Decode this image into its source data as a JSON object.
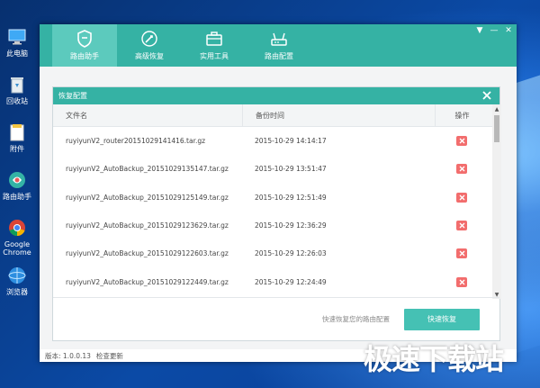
{
  "desktop": {
    "icons": [
      {
        "label": "此电脑",
        "icon": "computer-icon"
      },
      {
        "label": "回收站",
        "icon": "recycle-bin-icon"
      },
      {
        "label": "附件",
        "icon": "folder-icon"
      },
      {
        "label": "路由助手",
        "icon": "router-helper-icon"
      },
      {
        "label": "Google Chrome",
        "icon": "chrome-icon"
      },
      {
        "label": "浏览器",
        "icon": "browser-icon"
      }
    ]
  },
  "app": {
    "tabs": [
      {
        "label": "路由助手",
        "icon": "shield-icon",
        "active": true
      },
      {
        "label": "高级恢复",
        "icon": "rocket-icon",
        "active": false
      },
      {
        "label": "实用工具",
        "icon": "toolbox-icon",
        "active": false
      },
      {
        "label": "路由配置",
        "icon": "router-icon",
        "active": false
      }
    ],
    "window_controls": {
      "menu": "▼",
      "minimize": "—",
      "close": "✕"
    },
    "status": {
      "version": "版本: 1.0.0.13",
      "check_update": "检查更新"
    }
  },
  "dialog": {
    "title": "恢复配置",
    "columns": {
      "name": "文件名",
      "time": "备份时间",
      "action": "操作"
    },
    "rows": [
      {
        "name": "ruyiyunV2_router20151029141416.tar.gz",
        "time": "2015-10-29 14:14:17"
      },
      {
        "name": "ruyiyunV2_AutoBackup_20151029135147.tar.gz",
        "time": "2015-10-29 13:51:47"
      },
      {
        "name": "ruyiyunV2_AutoBackup_20151029125149.tar.gz",
        "time": "2015-10-29 12:51:49"
      },
      {
        "name": "ruyiyunV2_AutoBackup_20151029123629.tar.gz",
        "time": "2015-10-29 12:36:29"
      },
      {
        "name": "ruyiyunV2_AutoBackup_20151029122603.tar.gz",
        "time": "2015-10-29 12:26:03"
      },
      {
        "name": "ruyiyunV2_AutoBackup_20151029122449.tar.gz",
        "time": "2015-10-29 12:24:49"
      }
    ],
    "hint": "快速恢复您的路由配置",
    "restore_button": "快速恢复"
  },
  "watermark": "极速下载站",
  "colors": {
    "accent": "#35b2a4",
    "delete": "#f26d6d"
  }
}
